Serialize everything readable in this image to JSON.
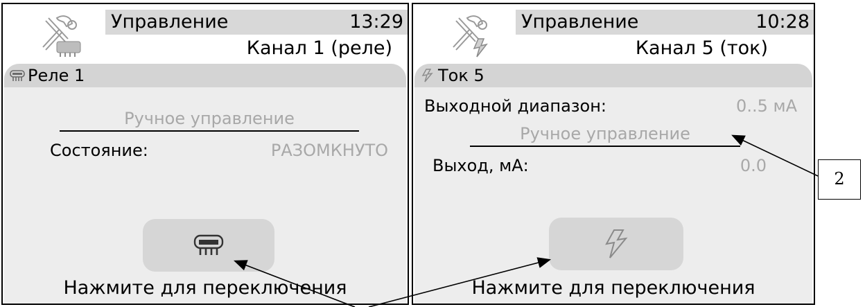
{
  "screen_left": {
    "header": {
      "title": "Управление",
      "time": "13:29",
      "subtitle": "Канал 1 (реле)"
    },
    "section": {
      "label": "Реле 1",
      "mode_label": "Ручное управление",
      "state_label": "Состояние:",
      "state_value": "РАЗОМКНУТО"
    },
    "hint": "Нажмите для переключения"
  },
  "screen_right": {
    "header": {
      "title": "Управление",
      "time": "10:28",
      "subtitle": "Канал 5 (ток)"
    },
    "section": {
      "label": "Ток 5",
      "range_label": "Выходной диапазон:",
      "range_value": "0..5 мА",
      "mode_label": "Ручное управление",
      "output_label": "Выход, мА:",
      "output_value": "0.0"
    },
    "hint": "Нажмите для переключения"
  },
  "callout": {
    "number": "2"
  },
  "icons": {
    "header_left": "tools-relay-icon",
    "header_right": "tools-current-icon",
    "relay": "relay-icon",
    "current": "lightning-icon"
  },
  "colors": {
    "header_bar": "#d8d8d8",
    "panel": "#ededed",
    "muted_text": "#a8a8a8",
    "button": "#d6d6d6"
  }
}
